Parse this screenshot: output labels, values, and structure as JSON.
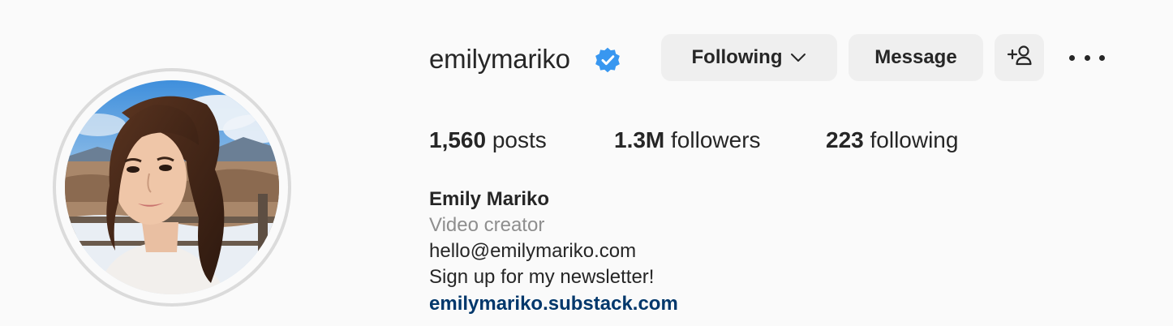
{
  "profile": {
    "username": "emilymariko",
    "verified": true,
    "buttons": {
      "following_label": "Following",
      "message_label": "Message"
    },
    "stats": {
      "posts_count": "1,560",
      "posts_label": "posts",
      "followers_count": "1.3M",
      "followers_label": "followers",
      "following_count": "223",
      "following_label": "following"
    },
    "bio": {
      "full_name": "Emily Mariko",
      "category": "Video creator",
      "email": "hello@emilymariko.com",
      "text": "Sign up for my newsletter!",
      "link": "emilymariko.substack.com"
    }
  },
  "icons": {
    "verified": "verified-badge-icon",
    "chevron": "chevron-down-icon",
    "add_user": "add-user-icon",
    "more": "more-options-icon"
  },
  "colors": {
    "background": "#fafafa",
    "button_bg": "#efefef",
    "verified_blue": "#3897f0",
    "link": "#00376b",
    "secondary_text": "#8e8e8e",
    "primary_text": "#262626"
  }
}
